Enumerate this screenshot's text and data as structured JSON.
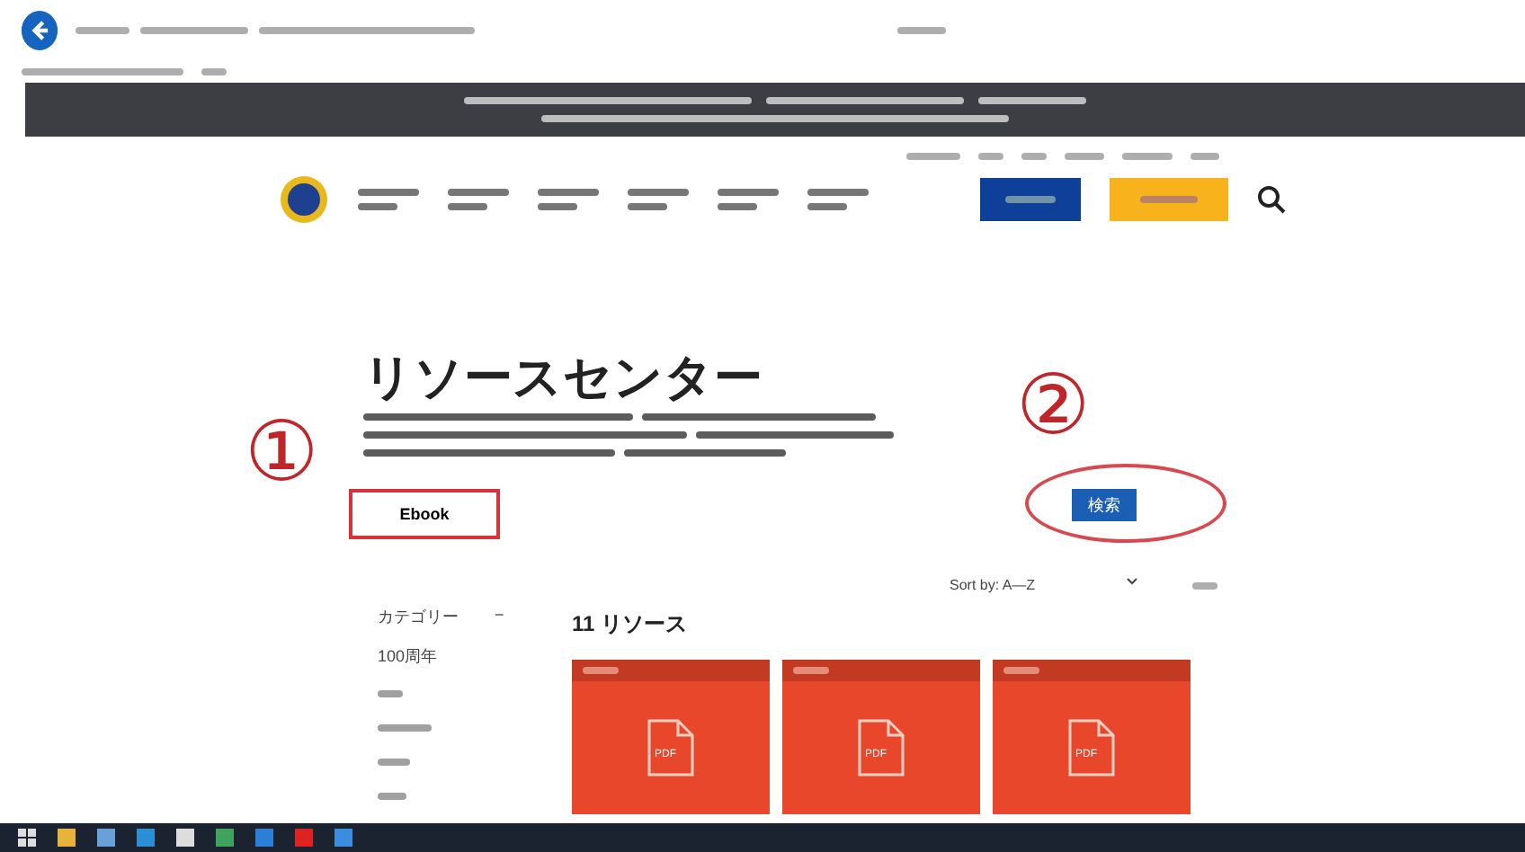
{
  "page": {
    "title": "リソースセンター",
    "filters": [
      {
        "label": "Ebook",
        "selected": true
      }
    ],
    "search_button": "検索",
    "annotations": [
      {
        "label": "①"
      },
      {
        "label": "②"
      }
    ]
  },
  "sort": {
    "label": "Sort by: A—Z"
  },
  "sidebar": {
    "heading": "カテゴリー",
    "toggle": "−",
    "items": [
      {
        "label": "100周年"
      }
    ]
  },
  "results": {
    "count": "11 リソース",
    "cards": [
      {
        "badge": "PDF"
      },
      {
        "badge": "PDF"
      },
      {
        "badge": "PDF"
      }
    ]
  }
}
